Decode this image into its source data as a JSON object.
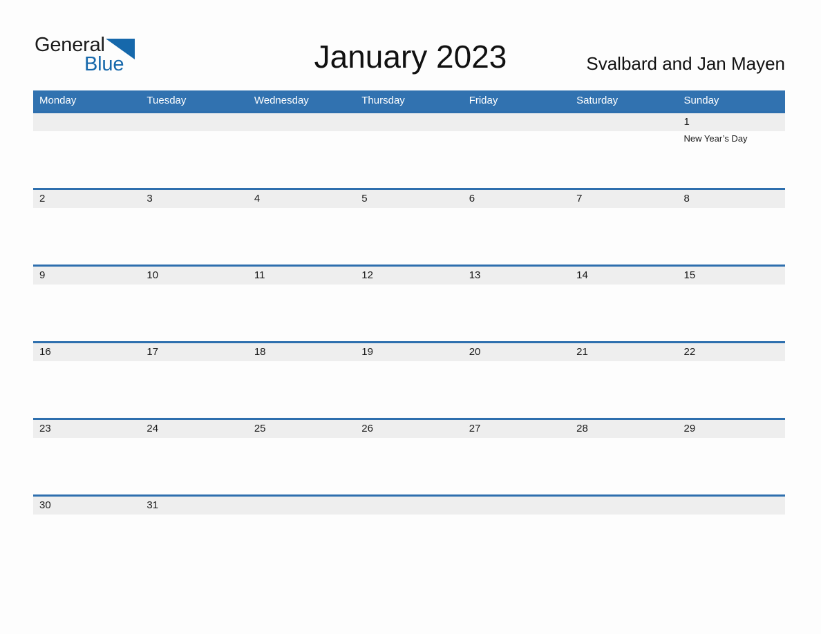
{
  "brand": {
    "name_part1": "General",
    "name_part2": "Blue",
    "accent_color": "#1668ab"
  },
  "header": {
    "title": "January 2023",
    "region": "Svalbard and Jan Mayen"
  },
  "theme": {
    "header_blue": "#3172b0",
    "separator_blue": "#2e6fae",
    "day_band_gray": "#eeeeee",
    "page_background": "#fdfdfd"
  },
  "calendar": {
    "weekdays": [
      "Monday",
      "Tuesday",
      "Wednesday",
      "Thursday",
      "Friday",
      "Saturday",
      "Sunday"
    ],
    "weeks": [
      {
        "days": [
          {
            "num": ""
          },
          {
            "num": ""
          },
          {
            "num": ""
          },
          {
            "num": ""
          },
          {
            "num": ""
          },
          {
            "num": ""
          },
          {
            "num": "1",
            "event": "New Year’s Day"
          }
        ]
      },
      {
        "days": [
          {
            "num": "2"
          },
          {
            "num": "3"
          },
          {
            "num": "4"
          },
          {
            "num": "5"
          },
          {
            "num": "6"
          },
          {
            "num": "7"
          },
          {
            "num": "8"
          }
        ]
      },
      {
        "days": [
          {
            "num": "9"
          },
          {
            "num": "10"
          },
          {
            "num": "11"
          },
          {
            "num": "12"
          },
          {
            "num": "13"
          },
          {
            "num": "14"
          },
          {
            "num": "15"
          }
        ]
      },
      {
        "days": [
          {
            "num": "16"
          },
          {
            "num": "17"
          },
          {
            "num": "18"
          },
          {
            "num": "19"
          },
          {
            "num": "20"
          },
          {
            "num": "21"
          },
          {
            "num": "22"
          }
        ]
      },
      {
        "days": [
          {
            "num": "23"
          },
          {
            "num": "24"
          },
          {
            "num": "25"
          },
          {
            "num": "26"
          },
          {
            "num": "27"
          },
          {
            "num": "28"
          },
          {
            "num": "29"
          }
        ]
      },
      {
        "days": [
          {
            "num": "30"
          },
          {
            "num": "31"
          },
          {
            "num": ""
          },
          {
            "num": ""
          },
          {
            "num": ""
          },
          {
            "num": ""
          },
          {
            "num": ""
          }
        ]
      }
    ]
  }
}
